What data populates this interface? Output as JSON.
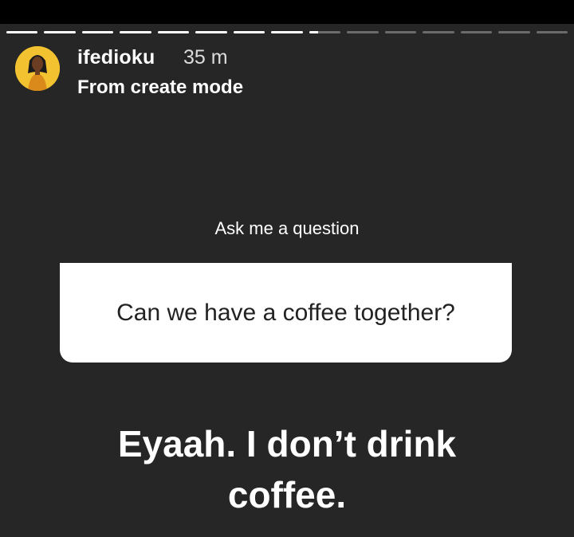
{
  "story": {
    "username": "ifedioku",
    "time": "35 m",
    "subtitle": "From create mode",
    "progress": {
      "segments": 15,
      "completed": 8,
      "current_fraction": 0.28
    }
  },
  "question_sticker": {
    "label": "Ask me a question",
    "question": "Can we have a coffee together?"
  },
  "answer": {
    "line1": "Eyaah. I don’t drink",
    "line2": "coffee."
  },
  "colors": {
    "background": "#262626",
    "avatar_ring": "#f2c230"
  }
}
